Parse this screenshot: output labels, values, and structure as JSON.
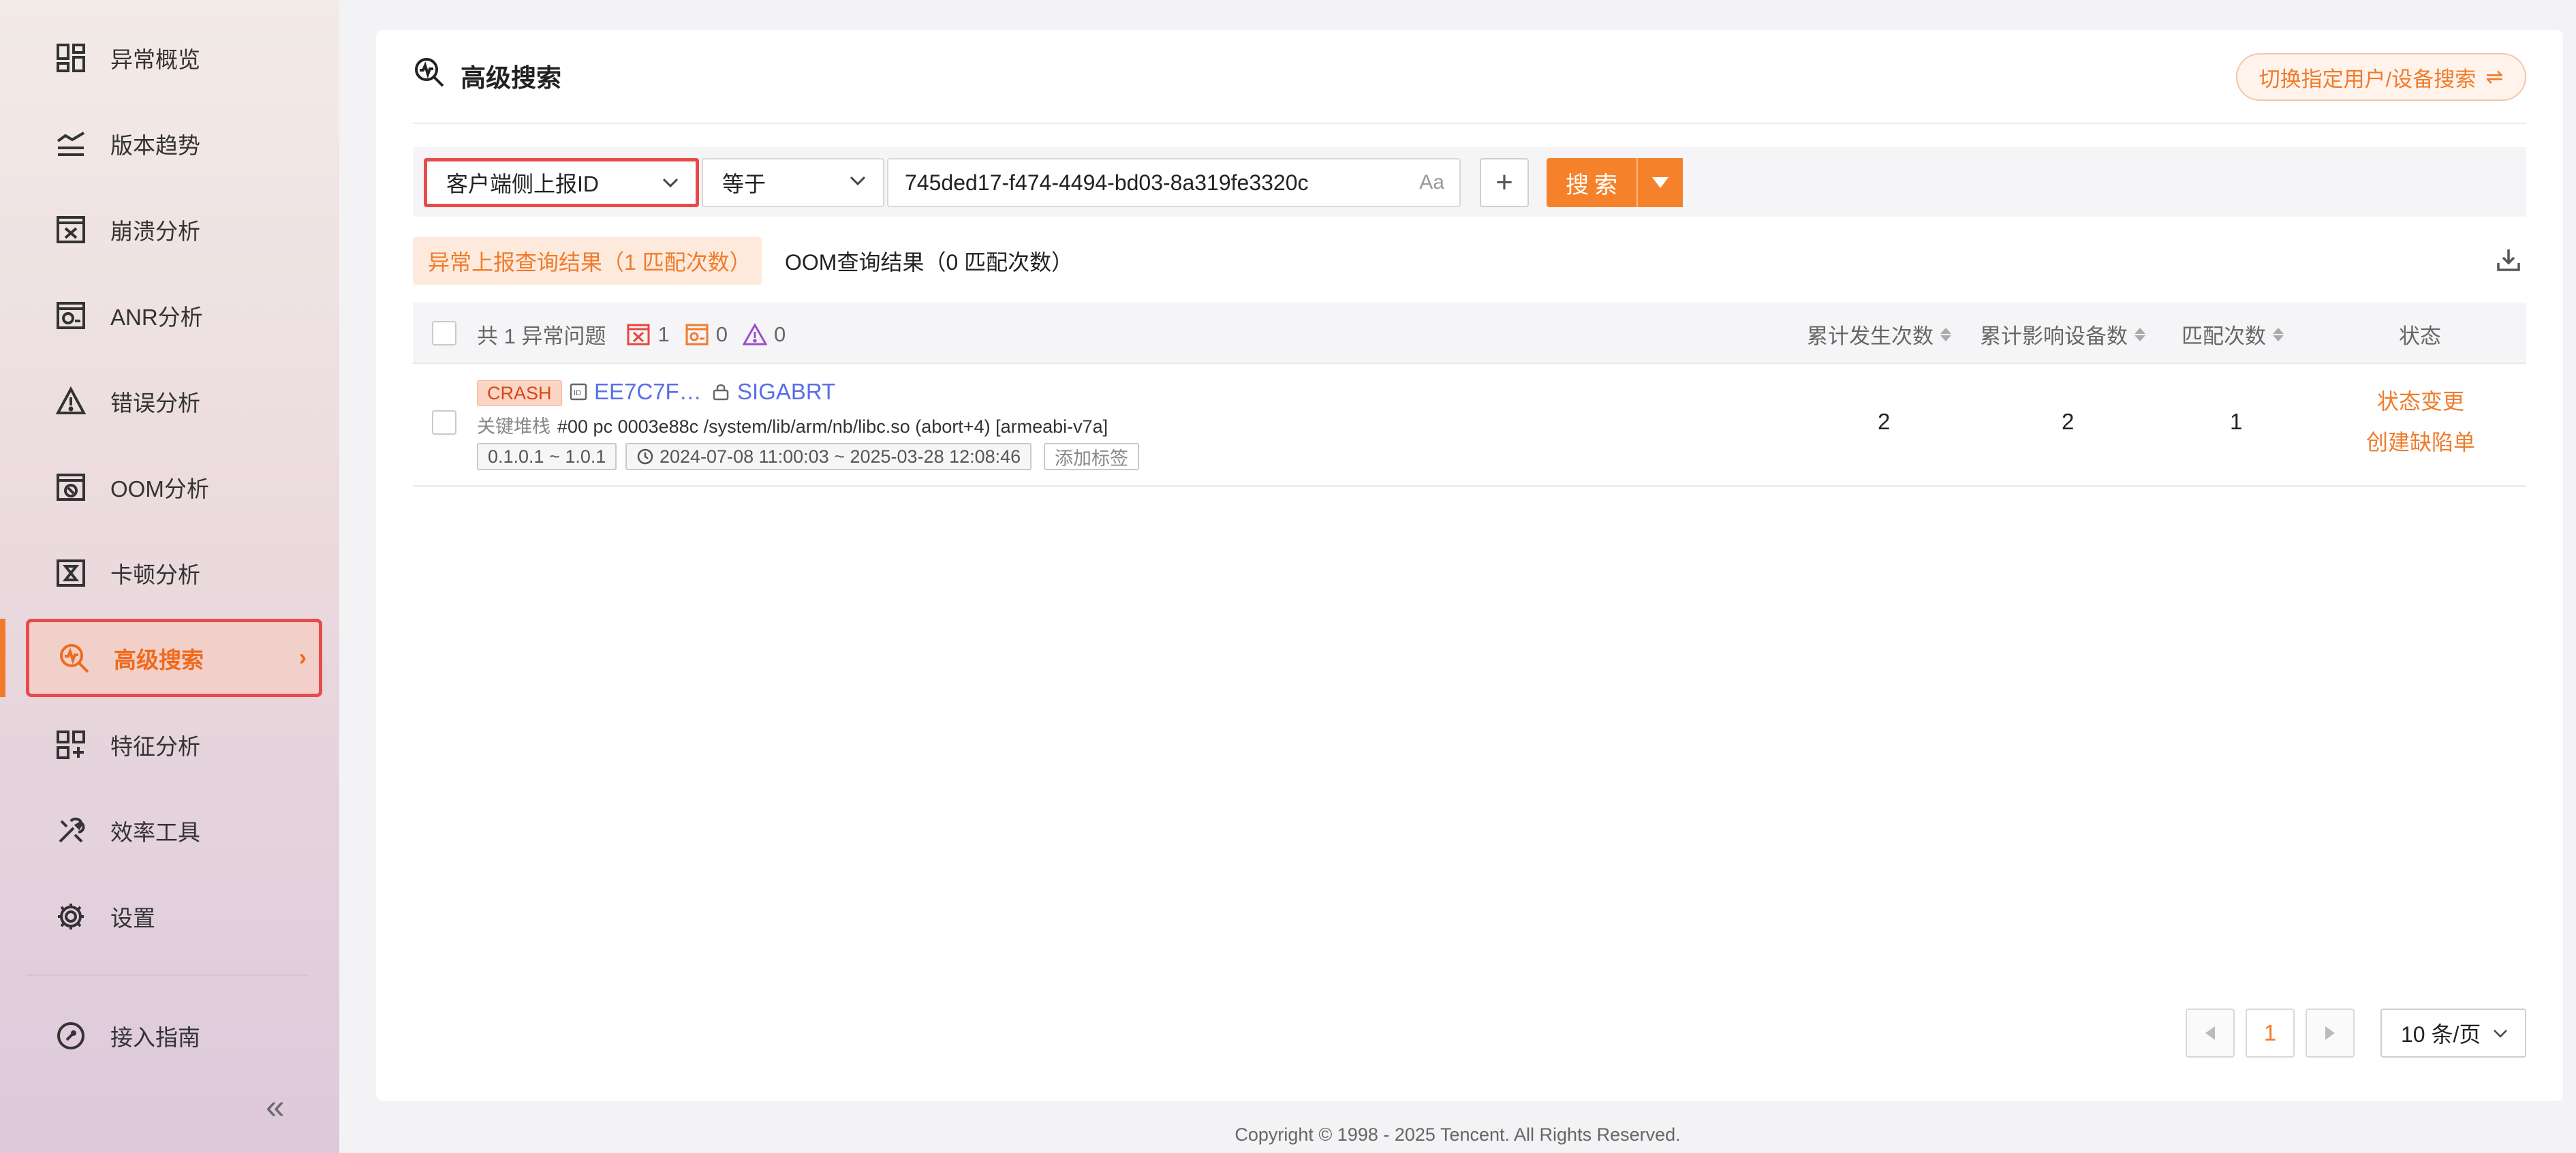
{
  "sidebar": {
    "items": [
      {
        "label": "异常概览",
        "icon": "dashboard-icon"
      },
      {
        "label": "版本趋势",
        "icon": "trend-icon"
      },
      {
        "label": "崩溃分析",
        "icon": "crash-icon"
      },
      {
        "label": "ANR分析",
        "icon": "anr-icon"
      },
      {
        "label": "错误分析",
        "icon": "warning-icon"
      },
      {
        "label": "OOM分析",
        "icon": "oom-icon"
      },
      {
        "label": "卡顿分析",
        "icon": "hourglass-icon"
      },
      {
        "label": "高级搜索",
        "icon": "advanced-search-icon",
        "active": true
      },
      {
        "label": "特征分析",
        "icon": "feature-icon"
      },
      {
        "label": "效率工具",
        "icon": "tools-icon"
      },
      {
        "label": "设置",
        "icon": "gear-icon"
      }
    ],
    "guide": {
      "label": "接入指南",
      "icon": "compass-icon"
    },
    "collapse_glyph": "«"
  },
  "header": {
    "title": "高级搜索",
    "switch_label": "切换指定用户/设备搜索",
    "switch_glyph": "⇌"
  },
  "filter": {
    "field": "客户端侧上报ID",
    "operator": "等于",
    "value": "745ded17-f474-4494-bd03-8a319fe3320c",
    "case_toggle": "Aa",
    "add_glyph": "+",
    "search_label": "搜索"
  },
  "tabs": {
    "active": "异常上报查询结果（1 匹配次数）",
    "other": "OOM查询结果（0 匹配次数）"
  },
  "table": {
    "summary": "共 1 异常问题",
    "crash_count": "1",
    "anr_count": "0",
    "error_count": "0",
    "headers": {
      "occurrences": "累计发生次数",
      "devices": "累计影响设备数",
      "matches": "匹配次数",
      "status": "状态"
    },
    "row": {
      "type": "CRASH",
      "issue_id": "EE7C7F…",
      "signal": "SIGABRT",
      "stack_label": "关键堆栈",
      "stack": "#00 pc 0003e88c /system/lib/arm/nb/libc.so (abort+4) [armeabi-v7a]",
      "versions": "0.1.0.1 ~ 1.0.1",
      "time_range": "2024-07-08 11:00:03 ~ 2025-03-28 12:08:46",
      "add_tag": "添加标签",
      "occurrences": "2",
      "devices": "2",
      "matches": "1",
      "action_status": "状态变更",
      "action_bug": "创建缺陷单"
    }
  },
  "pagination": {
    "current": "1",
    "page_size": "10 条/页"
  },
  "footer": "Copyright © 1998 - 2025 Tencent. All Rights Reserved.",
  "colors": {
    "accent": "#f5822a",
    "link": "#5a6ee8",
    "highlight_border": "#e84b4b"
  }
}
